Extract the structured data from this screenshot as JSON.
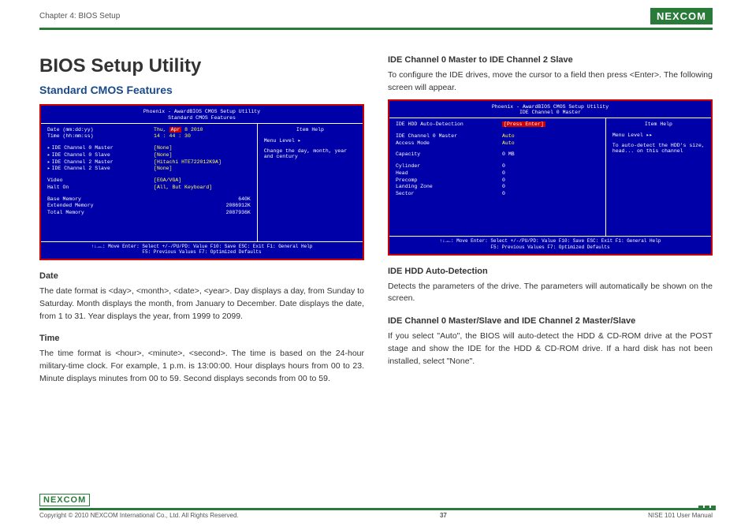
{
  "header": {
    "chapterLabel": "Chapter 4: BIOS Setup",
    "logoText": "NEXCOM"
  },
  "left": {
    "h1": "BIOS Setup Utility",
    "h2": "Standard CMOS Features",
    "bios1": {
      "title1": "Phoenix - AwardBIOS CMOS Setup Utility",
      "title2": "Standard CMOS Features",
      "rows": {
        "dateLabel": "Date (mm:dd:yy)",
        "dateVal": "Thu, Apr  8 2010",
        "dateValPre": "Thu, ",
        "dateValHighlight": "Apr",
        "dateValPost": "  8  2010",
        "timeLabel": "Time (hh:mm:ss)",
        "timeVal": "14 : 44 : 30",
        "ide0m": "IDE Channel 0 Master",
        "ide0s": "IDE Channel 0 Slave",
        "ide2m": "IDE Channel 2 Master",
        "ide2s": "IDE Channel 2 Slave",
        "none": "[None]",
        "hitachi": "[Hitachi HTE722012K9A]",
        "videoLabel": "Video",
        "videoVal": "[EGA/VGA]",
        "haltLabel": "Halt On",
        "haltVal": "[All, But Keyboard]",
        "baseMemLabel": "Base Memory",
        "baseMemVal": "640K",
        "extMemLabel": "Extended Memory",
        "extMemVal": "2086912K",
        "totalMemLabel": "Total Memory",
        "totalMemVal": "2087936K"
      },
      "help": {
        "itemHelp": "Item Help",
        "menuLevel": "Menu Level     ▸",
        "desc": "Change the day, month, year and century"
      },
      "footer1": "↑↓→←: Move       Enter: Select      +/-/PU/PD: Value          F10: Save       ESC: Exit       F1: General Help",
      "footer2": "F5: Previous Values                               F7: Optimized Defaults"
    },
    "dateH": "Date",
    "dateP": "The date format is <day>, <month>, <date>, <year>. Day displays a day, from Sunday to Saturday. Month displays the month, from January to December. Date displays the date, from 1 to 31. Year displays the year, from 1999 to 2099.",
    "timeH": "Time",
    "timeP": "The time format is <hour>, <minute>, <second>. The time is based on the 24-hour military-time clock. For example, 1 p.m. is 13:00:00. Hour displays hours from 00 to 23. Minute displays minutes from 00 to 59. Second displays seconds from 00 to 59."
  },
  "right": {
    "h3a": "IDE Channel 0 Master to IDE Channel 2 Slave",
    "p1": "To configure the IDE drives, move the cursor to a field then press <Enter>. The following screen will appear.",
    "bios2": {
      "title1": "Phoenix - AwardBIOS CMOS Setup Utility",
      "title2": "IDE Channel 0 Master",
      "rows": {
        "autoDetLabel": "IDE HDD Auto-Detection",
        "autoDetVal": "[Press Enter]",
        "ide0mLabel": "IDE Channel 0 Master",
        "ide0mVal": "Auto",
        "accessLabel": "Access Mode",
        "accessVal": "Auto",
        "capLabel": "Capacity",
        "capVal": "0 MB",
        "cylLabel": "Cylinder",
        "cylVal": "0",
        "headLabel": "Head",
        "headVal": "0",
        "preLabel": "Precomp",
        "preVal": "0",
        "lzLabel": "Landing Zone",
        "lzVal": "0",
        "secLabel": "Sector",
        "secVal": "0"
      },
      "help": {
        "itemHelp": "Item Help",
        "menuLevel": "Menu Level     ▸▸",
        "desc": "To auto-detect the HDD's size, head... on this channel"
      },
      "footer1": "↑↓→←: Move       Enter: Select      +/-/PU/PD: Value          F10: Save       ESC: Exit       F1: General Help",
      "footer2": "F5: Previous Values                               F7: Optimized Defaults"
    },
    "h3b": "IDE HDD Auto-Detection",
    "p2": "Detects the parameters of the drive. The parameters will automatically be shown on the screen.",
    "h3c": "IDE Channel 0 Master/Slave and IDE Channel 2 Master/Slave",
    "p3": "If you select \"Auto\", the BIOS will auto-detect the HDD & CD-ROM drive at the POST stage and show the IDE for the HDD & CD-ROM drive. If a hard disk has not been installed, select \"None\"."
  },
  "footer": {
    "logoText": "NEXCOM",
    "copyright": "Copyright © 2010 NEXCOM International Co., Ltd. All Rights Reserved.",
    "pageNum": "37",
    "docTitle": "NISE 101 User Manual"
  }
}
